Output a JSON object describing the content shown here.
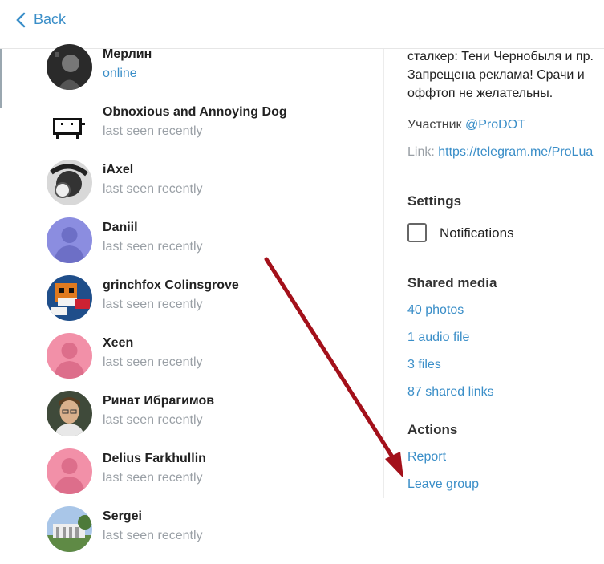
{
  "header": {
    "back_label": "Back"
  },
  "members": [
    {
      "name": "Мерлин",
      "status": "online",
      "online": true,
      "avatar": "photo-dark"
    },
    {
      "name": "Obnoxious and Annoying Dog",
      "status": "last seen recently",
      "online": false,
      "avatar": "pixel-dog"
    },
    {
      "name": "iAxel",
      "status": "last seen recently",
      "online": false,
      "avatar": "photo-bw"
    },
    {
      "name": "Daniil",
      "status": "last seen recently",
      "online": false,
      "avatar": "default-purple"
    },
    {
      "name": "grinchfox Colinsgrove",
      "status": "last seen recently",
      "online": false,
      "avatar": "pixel-fox"
    },
    {
      "name": "Xeen",
      "status": "last seen recently",
      "online": false,
      "avatar": "default-pink"
    },
    {
      "name": "Ринат Ибрагимов",
      "status": "last seen recently",
      "online": false,
      "avatar": "photo-face"
    },
    {
      "name": "Delius Farkhullin",
      "status": "last seen recently",
      "online": false,
      "avatar": "default-pink"
    },
    {
      "name": "Sergei",
      "status": "last seen recently",
      "online": false,
      "avatar": "photo-building"
    }
  ],
  "info": {
    "description": "сталкер: Тени Чернобыля и пр.\nЗапрещена реклама! Срачи и\nоффтоп не желательны.",
    "participant_prefix": "Участник ",
    "participant_handle": "@ProDOT",
    "link_prefix": "Link: ",
    "link_url": "https://telegram.me/ProLua"
  },
  "settings": {
    "title": "Settings",
    "notifications_label": "Notifications",
    "notifications_checked": false
  },
  "shared_media": {
    "title": "Shared media",
    "photos": "40 photos",
    "audio": "1 audio file",
    "files": "3 files",
    "links": "87 shared links"
  },
  "actions": {
    "title": "Actions",
    "report": "Report",
    "leave": "Leave group"
  },
  "colors": {
    "accent": "#3a8ec8",
    "arrow": "#a3101a",
    "purple": "#8b8de0",
    "pink": "#f290a8"
  }
}
